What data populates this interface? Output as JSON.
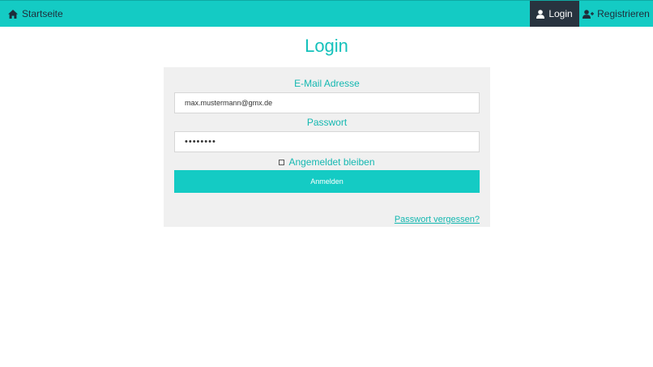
{
  "nav": {
    "home_label": "Startseite",
    "home_icon": "home-icon",
    "login_label": "Login",
    "login_icon": "user-icon",
    "register_label": "Registrieren",
    "register_icon": "user-plus-icon"
  },
  "page": {
    "title": "Login"
  },
  "form": {
    "email_label": "E-Mail Adresse",
    "email_value": "max.mustermann@gmx.de",
    "password_label": "Passwort",
    "password_value": "••••••••",
    "remember_label": "Angemeldet bleiben",
    "submit_label": "Anmelden",
    "forgot_label": "Passwort vergessen?"
  },
  "colors": {
    "accent": "#14cbc4",
    "nav_active": "#28333f",
    "panel_bg": "#f0f0f0"
  }
}
